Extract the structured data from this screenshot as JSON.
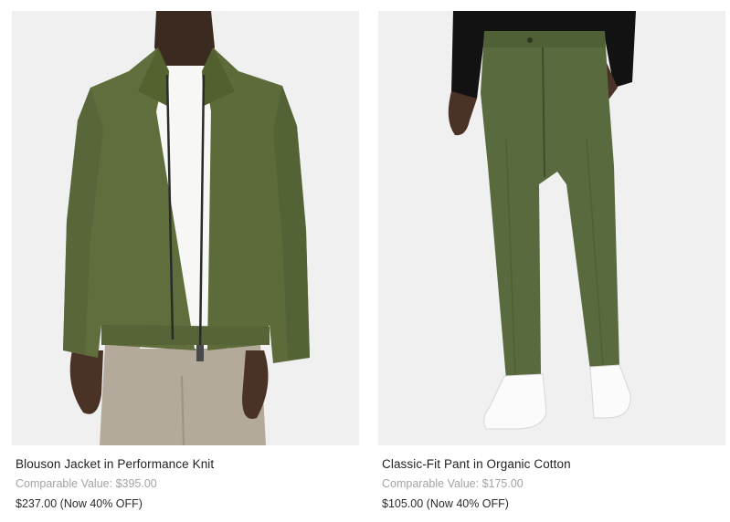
{
  "products": [
    {
      "name": "Blouson Jacket in Performance Knit",
      "comparable_label": "Comparable Value:",
      "comparable_value": "$395.00",
      "sale_price": "$237.00",
      "discount": "(Now 40% OFF)",
      "image": "olive-blouson-jacket-photo"
    },
    {
      "name": "Classic-Fit Pant in Organic Cotton",
      "comparable_label": "Comparable Value:",
      "comparable_value": "$175.00",
      "sale_price": "$105.00",
      "discount": "(Now 40% OFF)",
      "image": "olive-classic-pant-photo"
    }
  ],
  "colors": {
    "image_background": "#f0f0f0",
    "olive": "#5f6e3c",
    "comparable_text": "#a3a3a3"
  }
}
